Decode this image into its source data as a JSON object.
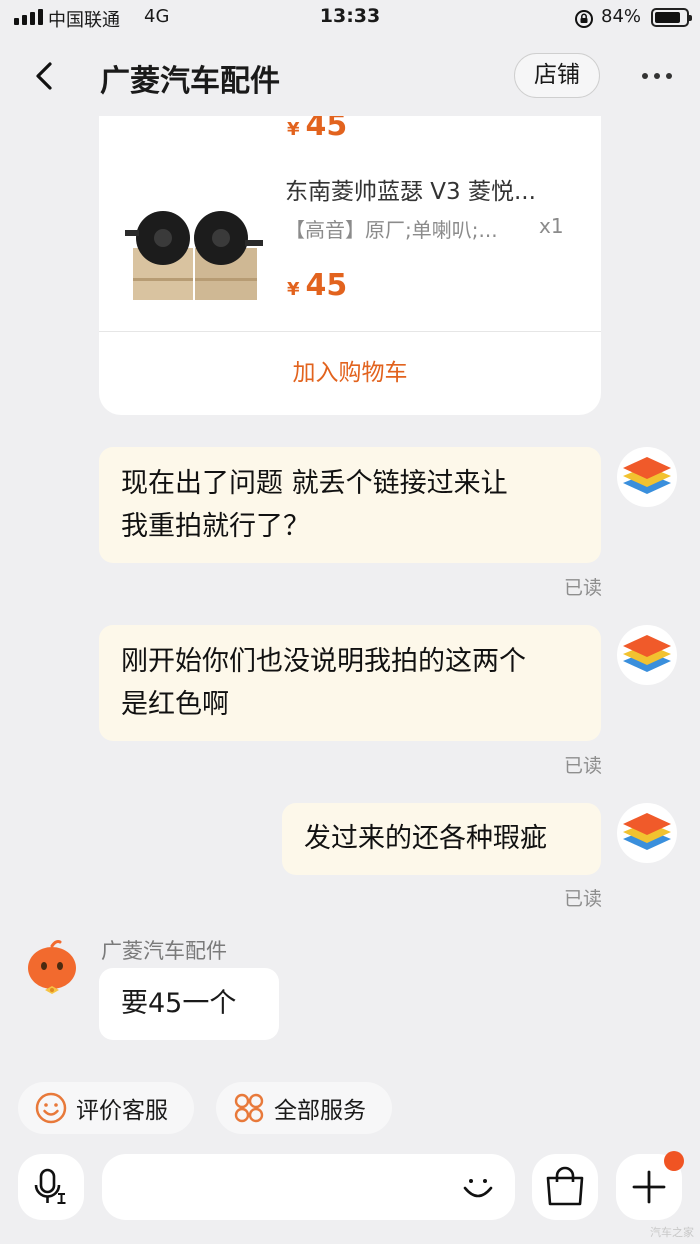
{
  "status_bar": {
    "carrier": "中国联通",
    "network": "4G",
    "time": "13:33",
    "battery_percent": "84%",
    "battery_level": 0.84
  },
  "header": {
    "title": "广菱汽车配件",
    "shop_label": "店铺"
  },
  "product_card": {
    "currency": "¥",
    "price_top": "45",
    "name": "东南菱帅蓝瑟 V3 菱悦...",
    "spec": "【高音】原厂;单喇叭;...",
    "quantity": "x1",
    "price": "45",
    "add_to_cart_label": "加入购物车"
  },
  "messages": [
    {
      "text_line1": "现在出了问题 就丢个链接过来让",
      "text_line2": "我重拍就行了？",
      "status": "已读"
    },
    {
      "text_line1": "刚开始你们也没说明我拍的这两个",
      "text_line2": "是红色啊",
      "status": "已读"
    },
    {
      "text": "发过来的还各种瑕疵",
      "status": "已读"
    }
  ],
  "shop_reply": {
    "sender": "广菱汽车配件",
    "text": "要45一个"
  },
  "quick_actions": {
    "rate_service": "评价客服",
    "all_services": "全部服务"
  },
  "watermark": "汽车之家",
  "icons": [
    "back-arrow-icon",
    "more-dots-icon",
    "voice-text-icon",
    "smile-icon",
    "shopping-bag-icon",
    "plus-icon",
    "smile-face-chip-icon",
    "services-grid-icon"
  ],
  "colors": {
    "accent": "#e2631e",
    "bubble_self": "#fdf8ea",
    "background": "#efeff1",
    "badge": "#f05423"
  }
}
